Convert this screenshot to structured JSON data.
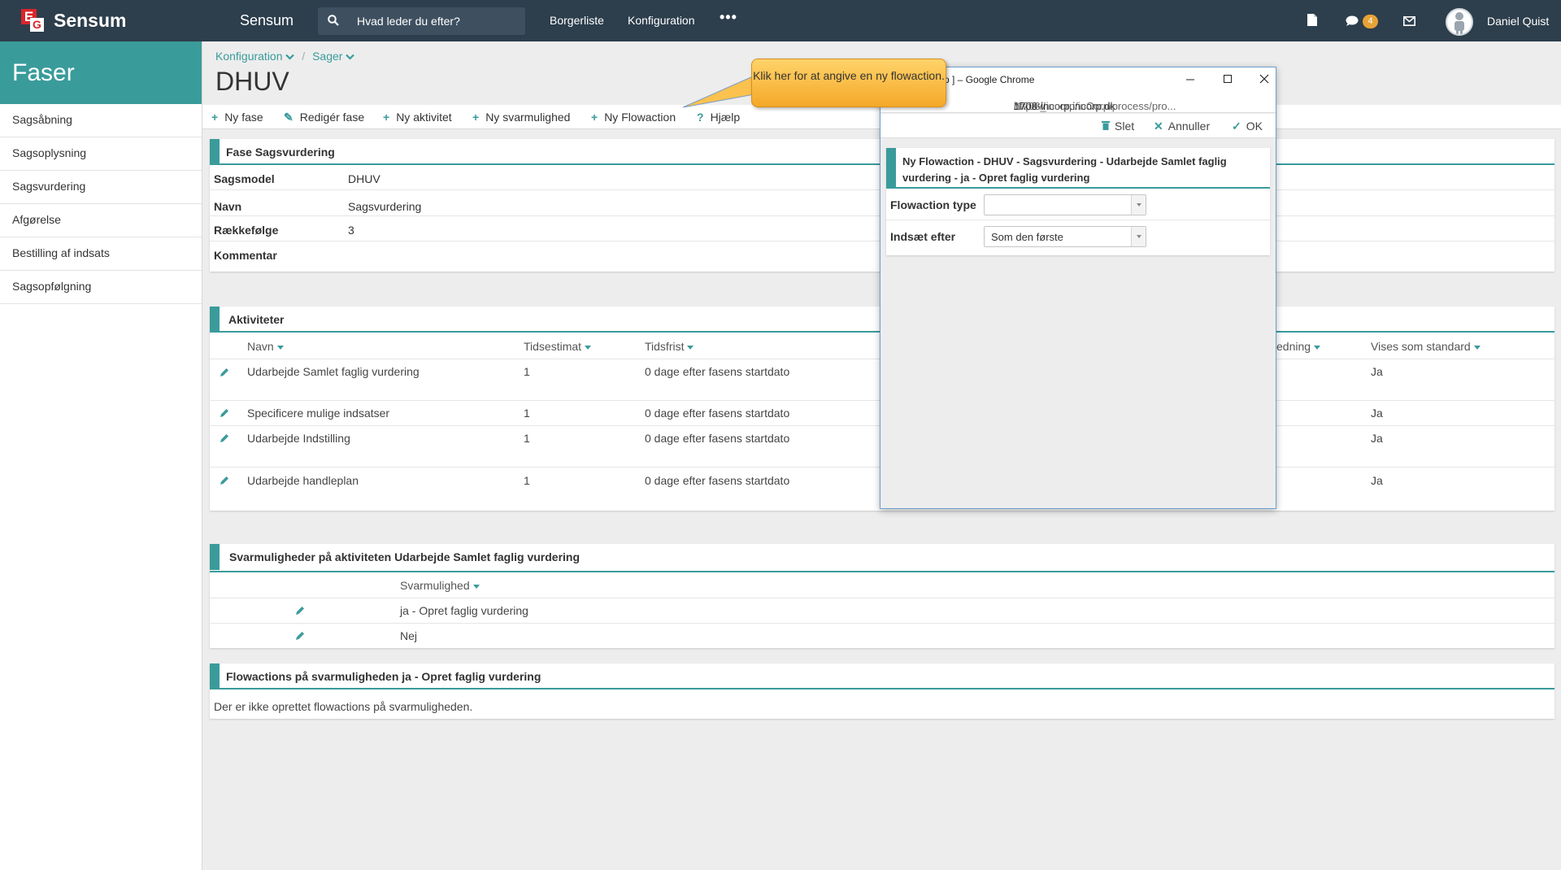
{
  "topbar": {
    "brand": "Sensum",
    "app_title": "Sensum",
    "search_placeholder": "Hvad leder du efter?",
    "nav": [
      "Borgerliste",
      "Konfiguration"
    ],
    "more": "•••",
    "chat_count": "4",
    "user_name": "Daniel Quist",
    "brand_color": "#2d3e4c",
    "accent_color": "#3a9b9b"
  },
  "sidebar": {
    "title": "Faser",
    "items": [
      "Sagsåbning",
      "Sagsoplysning",
      "Sagsvurdering",
      "Afgørelse",
      "Bestilling af indsats",
      "Sagsopfølgning"
    ]
  },
  "breadcrumb": {
    "level1": "Konfiguration",
    "level2": "Sager"
  },
  "page_title": "DHUV",
  "toolbar": {
    "new_phase": "Ny fase",
    "edit_phase": "Redigér fase",
    "new_activity": "Ny aktivitet",
    "new_answer": "Ny svarmulighed",
    "new_flowaction": "Ny Flowaction",
    "help": "Hjælp"
  },
  "phase_panel": {
    "title": "Fase Sagsvurdering",
    "rows": [
      {
        "label": "Sagsmodel",
        "value": "DHUV"
      },
      {
        "label": "Navn",
        "value": "Sagsvurdering"
      },
      {
        "label": "Rækkefølge",
        "value": "3"
      },
      {
        "label": "Kommentar",
        "value": ""
      }
    ]
  },
  "activities_panel": {
    "title": "Aktiviteter",
    "columns": {
      "name": "Navn",
      "estimate": "Tidsestimat",
      "deadline": "Tidsfrist",
      "guidance": "edning",
      "default": "Vises som standard"
    },
    "rows": [
      {
        "name": "Udarbejde Samlet faglig vurdering",
        "estimate": "1",
        "deadline": "0 dage efter fasens startdato",
        "default": "Ja"
      },
      {
        "name": "Specificere mulige indsatser",
        "estimate": "1",
        "deadline": "0 dage efter fasens startdato",
        "default": "Ja"
      },
      {
        "name": "Udarbejde Indstilling",
        "estimate": "1",
        "deadline": "0 dage efter fasens startdato",
        "default": "Ja"
      },
      {
        "name": "Udarbejde handleplan",
        "estimate": "1",
        "deadline": "0 dage efter fasens startdato",
        "default": "Ja"
      }
    ]
  },
  "answers_panel": {
    "title": "Svarmuligheder på aktiviteten Udarbejde Samlet faglig vurdering",
    "column": "Svarmulighed",
    "rows": [
      "ja - Opret faglig vurdering",
      "Nej"
    ]
  },
  "flowactions_panel": {
    "title": "Flowactions på svarmuligheden ja - Opret faglig vurdering",
    "empty_text": "Der er ikke oprettet flowactions på svarmuligheden."
  },
  "dialog": {
    "window_title": "p ] – Google Chrome",
    "url_scheme": "https://",
    "url_host": "1708-incorp.incorp.dk",
    "url_path": "/1708_incorp/inCorp/process/pro...",
    "actions": {
      "delete": "Slet",
      "cancel": "Annuller",
      "ok": "OK"
    },
    "panel_title": "Ny Flowaction - DHUV - Sagsvurdering - Udarbejde Samlet faglig vurdering - ja - Opret faglig vurdering",
    "fields": [
      {
        "label": "Flowaction type",
        "value": ""
      },
      {
        "label": "Indsæt efter",
        "value": "Som den første"
      }
    ]
  },
  "callout": {
    "text": "Klik her for at angive en ny flowaction."
  }
}
